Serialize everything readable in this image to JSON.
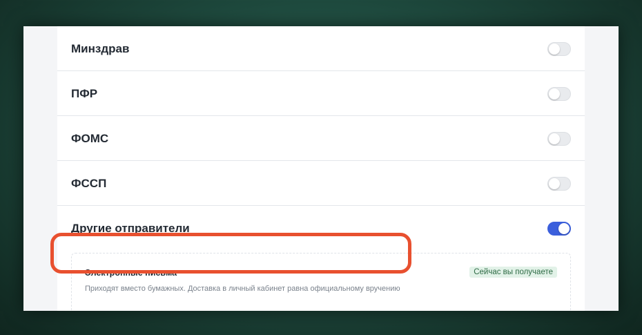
{
  "rows": [
    {
      "label": "Минздрав",
      "enabled": false
    },
    {
      "label": "ПФР",
      "enabled": false
    },
    {
      "label": "ФОМС",
      "enabled": false
    },
    {
      "label": "ФССП",
      "enabled": false
    },
    {
      "label": "Другие отправители",
      "enabled": true
    }
  ],
  "sub_option": {
    "title": "Электронные письма",
    "description": "Приходят вместо бумажных. Доставка в личный кабинет равна официальному вручению",
    "status_badge": "Сейчас вы получаете"
  },
  "colors": {
    "toggle_on": "#3b5fdc",
    "toggle_off": "#e9ebee",
    "badge_bg": "#e2f2e8",
    "badge_text": "#2e6b45",
    "highlight": "#e8502f"
  }
}
